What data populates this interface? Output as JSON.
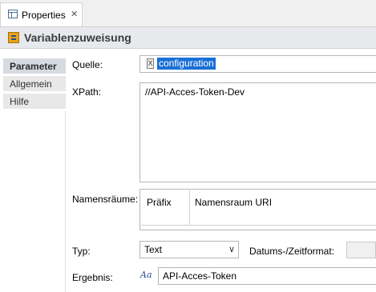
{
  "tab": {
    "label": "Properties",
    "close_glyph": "✕",
    "icon": "properties-view-icon"
  },
  "header": {
    "title": "Variablenzuweisung",
    "icon": "variable-assignment-icon"
  },
  "nav": {
    "items": [
      "Parameter",
      "Allgemein",
      "Hilfe"
    ],
    "active": "Parameter"
  },
  "form": {
    "source_label": "Quelle:",
    "source_value": "configuration",
    "source_icon": "xml-document-icon",
    "xpath_label": "XPath:",
    "xpath_value": "//API-Acces-Token-Dev",
    "namespaces_label": "Namensräume:",
    "ns_columns": [
      "Präfix",
      "Namensraum URI"
    ],
    "type_label": "Typ:",
    "type_value": "Text",
    "dateformat_label": "Datums-/Zeitformat:",
    "result_label": "Ergebnis:",
    "result_icon_text": "Aa",
    "result_value": "API-Acces-Token"
  },
  "colors": {
    "selection": "#1a6fd6",
    "header_bg": "#e7e9ed",
    "nav_active_bg": "#d6dbe2"
  }
}
